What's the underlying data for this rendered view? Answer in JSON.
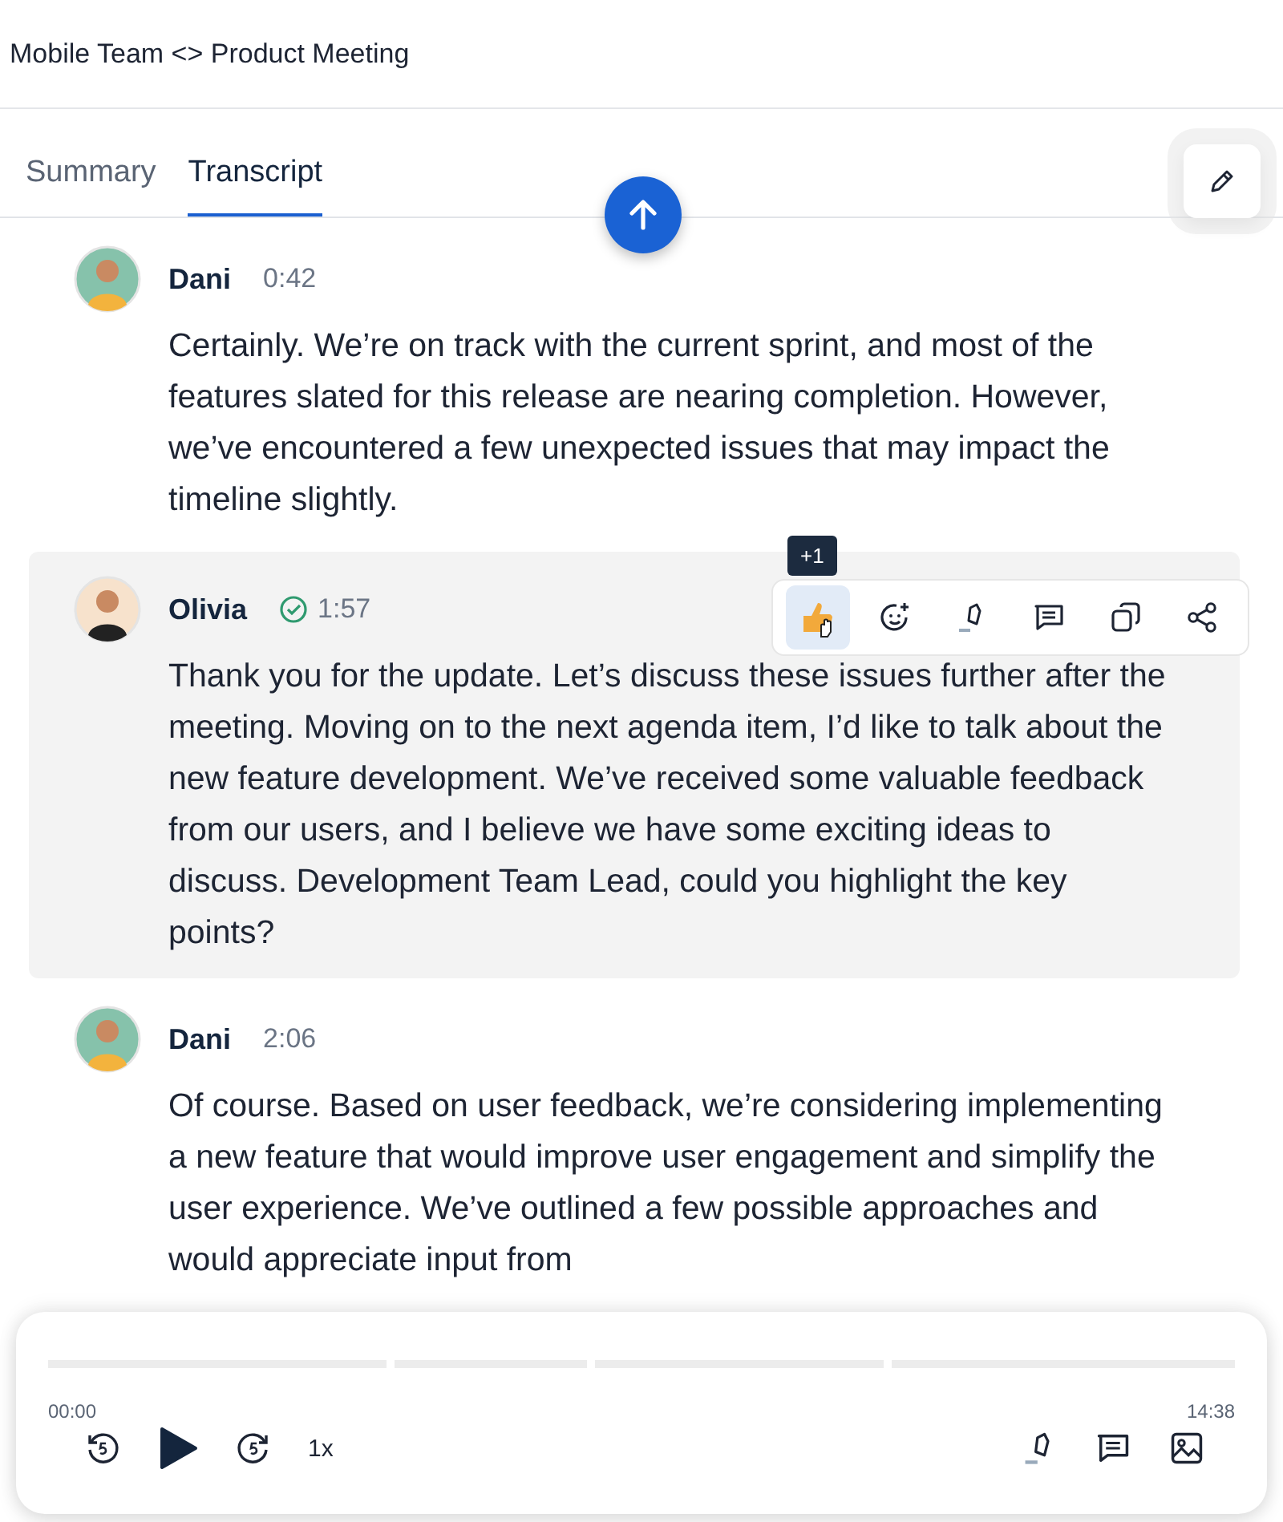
{
  "title": "Mobile Team <> Product Meeting",
  "tabs": [
    {
      "label": "Summary",
      "selected": false
    },
    {
      "label": "Transcript",
      "selected": true
    }
  ],
  "messages": [
    {
      "speaker": "Dani",
      "time": "0:42",
      "verified": false,
      "highlighted": false,
      "text": "Certainly. We’re on track with the current sprint, and most of the features slated for this release are nearing completion. However, we’ve encountered a few unexpected issues that may impact the timeline slightly."
    },
    {
      "speaker": "Olivia",
      "time": "1:57",
      "verified": true,
      "highlighted": true,
      "text": "Thank you for the update. Let’s discuss these issues further after the meeting. Moving on to the next agenda item, I’d like to talk about the new feature development. We’ve received some valuable feedback from our users, and I believe we have some exciting ideas to discuss. Development Team Lead, could you highlight the key points?"
    },
    {
      "speaker": "Dani",
      "time": "2:06",
      "verified": false,
      "highlighted": false,
      "text": "Of course. Based on user feedback, we’re considering implementing a new feature that would improve user engagement and simplify the user experience. We’ve outlined a few possible approaches and would appreciate input from"
    }
  ],
  "tooltip": "+1",
  "actions": [
    {
      "kind": "like",
      "selected": true
    },
    {
      "kind": "emoji",
      "selected": false
    },
    {
      "kind": "highlight",
      "selected": false
    },
    {
      "kind": "comment",
      "selected": false
    },
    {
      "kind": "copy",
      "selected": false
    },
    {
      "kind": "share",
      "selected": false
    }
  ],
  "player": {
    "current": "00:00",
    "total": "14:38",
    "speed": "1x"
  }
}
